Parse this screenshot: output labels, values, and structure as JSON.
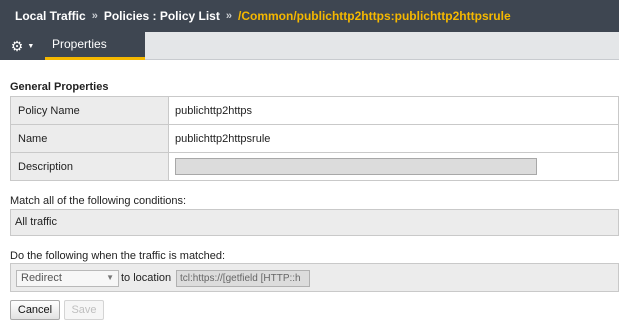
{
  "breadcrumb": {
    "item1": "Local Traffic",
    "item2": "Policies : Policy List",
    "current": "/Common/publichttp2https:publichttp2httpsrule",
    "separator": "»"
  },
  "tabs": {
    "properties_label": "Properties"
  },
  "icons": {
    "menu": "gear-icon",
    "menu_caret": "caret-down-icon",
    "select_caret": "chevron-down-icon"
  },
  "colors": {
    "header_bg": "#3e4651",
    "accent": "#f5b800",
    "label_bg": "#ececec"
  },
  "general": {
    "title": "General Properties",
    "rows": [
      {
        "label": "Policy Name",
        "value": "publichttp2https"
      },
      {
        "label": "Name",
        "value": "publichttp2httpsrule"
      },
      {
        "label": "Description",
        "value": ""
      }
    ]
  },
  "conditions": {
    "label": "Match all of the following conditions:",
    "value": "All traffic"
  },
  "actions": {
    "label": "Do the following when the traffic is matched:",
    "action_select": "Redirect",
    "to_location_label": "to location",
    "location_value": "tcl:https://[getfield [HTTP::h"
  },
  "buttons": {
    "cancel": "Cancel",
    "save": "Save"
  }
}
